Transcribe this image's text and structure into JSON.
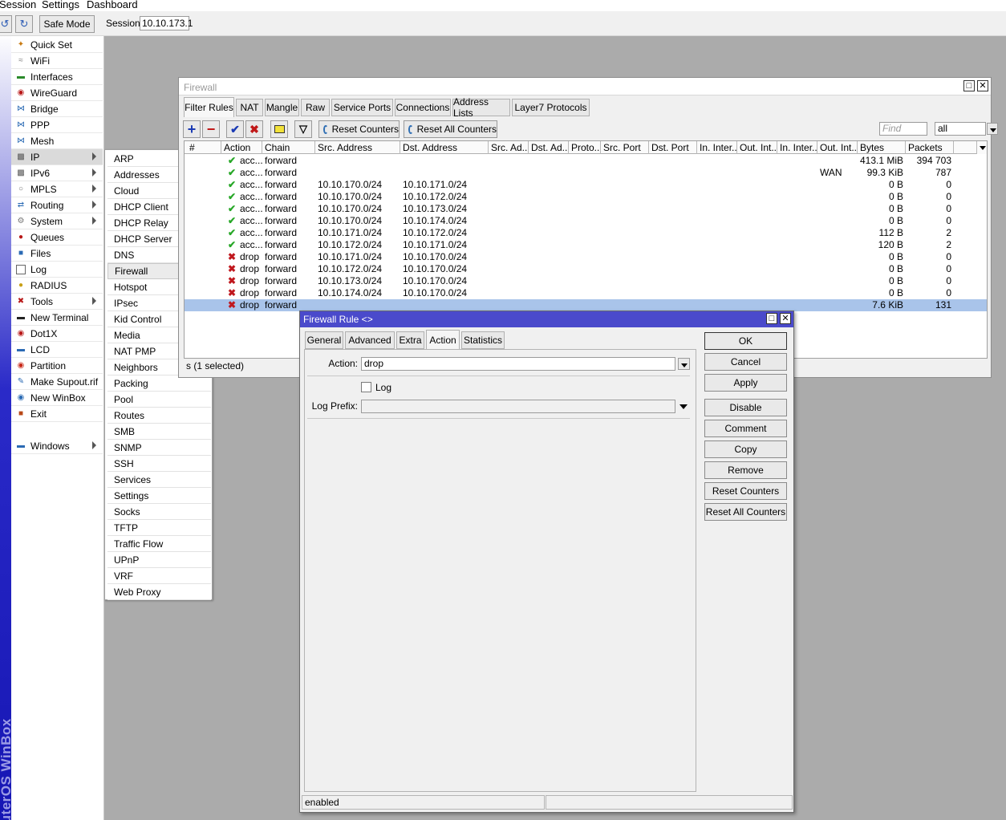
{
  "menubar": {
    "items": [
      "Session",
      "Settings",
      "Dashboard"
    ]
  },
  "toolbar": {
    "safe_mode": "Safe Mode",
    "session_label": "Session:",
    "session_value": "10.10.173.1"
  },
  "brand": "RouterOS WinBox",
  "mainmenu": {
    "items": [
      {
        "label": "Quick Set",
        "icon": "wand-icon",
        "color": "#c87a12"
      },
      {
        "label": "WiFi",
        "icon": "wifi-icon",
        "color": "#808080"
      },
      {
        "label": "Interfaces",
        "icon": "interfaces-icon",
        "color": "#2a8a2a"
      },
      {
        "label": "WireGuard",
        "icon": "wireguard-icon",
        "color": "#b81818"
      },
      {
        "label": "Bridge",
        "icon": "bridge-icon",
        "color": "#2a6ab4"
      },
      {
        "label": "PPP",
        "icon": "ppp-icon",
        "color": "#2a6ab4"
      },
      {
        "label": "Mesh",
        "icon": "mesh-icon",
        "color": "#2a6ab4"
      },
      {
        "label": "IP",
        "icon": "ip-icon",
        "color": "#555555"
      },
      {
        "label": "IPv6",
        "icon": "ipv6-icon",
        "color": "#555555"
      },
      {
        "label": "MPLS",
        "icon": "mpls-icon",
        "color": "#777777"
      },
      {
        "label": "Routing",
        "icon": "routing-icon",
        "color": "#2a6ab4"
      },
      {
        "label": "System",
        "icon": "system-icon",
        "color": "#777777"
      },
      {
        "label": "Queues",
        "icon": "queues-icon",
        "color": "#b81818"
      },
      {
        "label": "Files",
        "icon": "files-icon",
        "color": "#2a6ab4"
      },
      {
        "label": "Log",
        "icon": "log-icon",
        "color": "#ffffff"
      },
      {
        "label": "RADIUS",
        "icon": "radius-icon",
        "color": "#c8a018"
      },
      {
        "label": "Tools",
        "icon": "tools-icon",
        "color": "#b81818"
      },
      {
        "label": "New Terminal",
        "icon": "terminal-icon",
        "color": "#222222"
      },
      {
        "label": "Dot1X",
        "icon": "dot1x-icon",
        "color": "#b81818"
      },
      {
        "label": "LCD",
        "icon": "lcd-icon",
        "color": "#2a6ab4"
      },
      {
        "label": "Partition",
        "icon": "partition-icon",
        "color": "#c82818"
      },
      {
        "label": "Make Supout.rif",
        "icon": "supout-icon",
        "color": "#2a6ab4"
      },
      {
        "label": "New WinBox",
        "icon": "winbox-icon",
        "color": "#2a6ab4"
      },
      {
        "label": "Exit",
        "icon": "exit-icon",
        "color": "#b84818"
      },
      {
        "label": "Windows",
        "icon": "windows-icon",
        "color": "#2a6ab4"
      }
    ]
  },
  "submenu": {
    "items": [
      "ARP",
      "Addresses",
      "Cloud",
      "DHCP Client",
      "DHCP Relay",
      "DHCP Server",
      "DNS",
      "Firewall",
      "Hotspot",
      "IPsec",
      "Kid Control",
      "Media",
      "NAT PMP",
      "Neighbors",
      "Packing",
      "Pool",
      "Routes",
      "SMB",
      "SNMP",
      "SSH",
      "Services",
      "Settings",
      "Socks",
      "TFTP",
      "Traffic Flow",
      "UPnP",
      "VRF",
      "Web Proxy"
    ],
    "active": "Firewall"
  },
  "firewall": {
    "title": "Firewall",
    "tabs": [
      "Filter Rules",
      "NAT",
      "Mangle",
      "Raw",
      "Service Ports",
      "Connections",
      "Address Lists",
      "Layer7 Protocols"
    ],
    "reset_counters": "Reset Counters",
    "reset_all_counters": "Reset All Counters",
    "find_placeholder": "Find",
    "filter_value": "all",
    "columns": [
      "#",
      "Action",
      "Chain",
      "Src. Address",
      "Dst. Address",
      "Src. Ad...",
      "Dst. Ad...",
      "Proto...",
      "Src. Port",
      "Dst. Port",
      "In. Inter...",
      "Out. Int...",
      "In. Inter...",
      "Out. Int...",
      "Bytes",
      "Packets"
    ],
    "rows": [
      {
        "action": "acc...",
        "type": "accept",
        "chain": "forward",
        "src": "",
        "dst": "",
        "out_int": "",
        "bytes": "413.1 MiB",
        "packets": "394 703"
      },
      {
        "action": "acc...",
        "type": "accept",
        "chain": "forward",
        "src": "",
        "dst": "",
        "out_int": "WAN",
        "bytes": "99.3 KiB",
        "packets": "787"
      },
      {
        "action": "acc...",
        "type": "accept",
        "chain": "forward",
        "src": "10.10.170.0/24",
        "dst": "10.10.171.0/24",
        "out_int": "",
        "bytes": "0 B",
        "packets": "0"
      },
      {
        "action": "acc...",
        "type": "accept",
        "chain": "forward",
        "src": "10.10.170.0/24",
        "dst": "10.10.172.0/24",
        "out_int": "",
        "bytes": "0 B",
        "packets": "0"
      },
      {
        "action": "acc...",
        "type": "accept",
        "chain": "forward",
        "src": "10.10.170.0/24",
        "dst": "10.10.173.0/24",
        "out_int": "",
        "bytes": "0 B",
        "packets": "0"
      },
      {
        "action": "acc...",
        "type": "accept",
        "chain": "forward",
        "src": "10.10.170.0/24",
        "dst": "10.10.174.0/24",
        "out_int": "",
        "bytes": "0 B",
        "packets": "0"
      },
      {
        "action": "acc...",
        "type": "accept",
        "chain": "forward",
        "src": "10.10.171.0/24",
        "dst": "10.10.172.0/24",
        "out_int": "",
        "bytes": "112 B",
        "packets": "2"
      },
      {
        "action": "acc...",
        "type": "accept",
        "chain": "forward",
        "src": "10.10.172.0/24",
        "dst": "10.10.171.0/24",
        "out_int": "",
        "bytes": "120 B",
        "packets": "2"
      },
      {
        "action": "drop",
        "type": "drop",
        "chain": "forward",
        "src": "10.10.171.0/24",
        "dst": "10.10.170.0/24",
        "out_int": "",
        "bytes": "0 B",
        "packets": "0"
      },
      {
        "action": "drop",
        "type": "drop",
        "chain": "forward",
        "src": "10.10.172.0/24",
        "dst": "10.10.170.0/24",
        "out_int": "",
        "bytes": "0 B",
        "packets": "0"
      },
      {
        "action": "drop",
        "type": "drop",
        "chain": "forward",
        "src": "10.10.173.0/24",
        "dst": "10.10.170.0/24",
        "out_int": "",
        "bytes": "0 B",
        "packets": "0"
      },
      {
        "action": "drop",
        "type": "drop",
        "chain": "forward",
        "src": "10.10.174.0/24",
        "dst": "10.10.170.0/24",
        "out_int": "",
        "bytes": "0 B",
        "packets": "0"
      },
      {
        "action": "drop",
        "type": "drop",
        "chain": "forward",
        "src": "",
        "dst": "",
        "out_int": "",
        "bytes": "7.6 KiB",
        "packets": "131",
        "selected": true
      }
    ],
    "status": "s (1 selected)"
  },
  "rule_dialog": {
    "title": "Firewall Rule <>",
    "tabs": [
      "General",
      "Advanced",
      "Extra",
      "Action",
      "Statistics"
    ],
    "active_tab": "Action",
    "action_label": "Action:",
    "action_value": "drop",
    "log_label": "Log",
    "log_prefix_label": "Log Prefix:",
    "log_prefix_value": "",
    "buttons": [
      "OK",
      "Cancel",
      "Apply",
      "Disable",
      "Comment",
      "Copy",
      "Remove",
      "Reset Counters",
      "Reset All Counters"
    ],
    "status": "enabled"
  },
  "colors": {
    "accept": "#27a727",
    "drop": "#c0181e",
    "title_active": "#4a4acb",
    "selection": "#a9c4ea"
  }
}
